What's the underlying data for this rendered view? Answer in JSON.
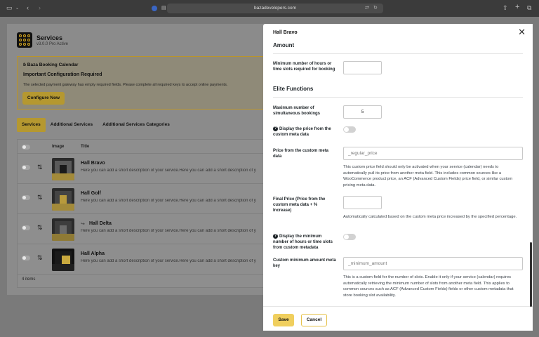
{
  "browser": {
    "url": "bazadevelopers.com"
  },
  "background": {
    "title": "Services",
    "version": "v3.0.0 Pro Active",
    "notice": {
      "brand": "Baza Booking Calendar",
      "heading": "Important Configuration Required",
      "body": "The selected payment gateway has empty required fields. Please complete all required keys to accept online payments.",
      "button": "Configure Now"
    },
    "tabs": [
      "Services",
      "Additional Services",
      "Additional Services Categories"
    ],
    "columns": {
      "image": "Image",
      "title": "Title"
    },
    "rows": [
      {
        "name": "Hall Bravo",
        "desc": "Here you can add a short description of your service.Here you can add a short description of y"
      },
      {
        "name": "Hall Golf",
        "desc": "Here you can add a short description of your service.Here you can add a short description of y"
      },
      {
        "name": "Hall Delta",
        "desc": "Here you can add a short description of your service.Here you can add a short description of y",
        "child": true
      },
      {
        "name": "Hall Alpha",
        "desc": "Here you can add a short description of your service.Here you can add a short description of y"
      }
    ],
    "count": "4 items"
  },
  "panel": {
    "title": "Hall Bravo",
    "amount": {
      "heading": "Amount",
      "min_hours_label": "Minimum number of hours or time slots required for booking",
      "min_hours_value": ""
    },
    "elite": {
      "heading": "Elite Functions",
      "max_simultaneous_label": "Maximum number of simultaneous bookings",
      "max_simultaneous_value": "5",
      "display_price_label": "Display the price from the custom meta data",
      "price_meta_label": "Price from the custom meta data",
      "price_meta_placeholder": "_regular_price",
      "price_meta_help": "This custom price field should only be activated when your service (calendar) needs to automatically pull its price from another meta field. This includes common sources like a WooCommerce product price, an ACF (Advanced Custom Fields) price field, or similar custom pricing meta data.",
      "final_price_label": "Final Price (Price from the custom meta data + % Increase)",
      "final_price_value": "",
      "final_price_help": "Automatically calculated based on the custom meta price increased by the specified percentage.",
      "display_min_label": "Display the minimum number of hours or time slots from custom metadata",
      "min_meta_label": "Custom minimum amount meta key",
      "min_meta_placeholder": "_minimum_amount",
      "min_meta_help": "This is a custom field for the number of slots. Enable it only if your service (calendar) requires automatically retrieving the minimum number of slots from another meta field. This applies to common sources such as ACF (Advanced Custom Fields) fields or other custom metadata that store booking slot availability."
    },
    "footer": {
      "save": "Save",
      "cancel": "Cancel"
    }
  }
}
